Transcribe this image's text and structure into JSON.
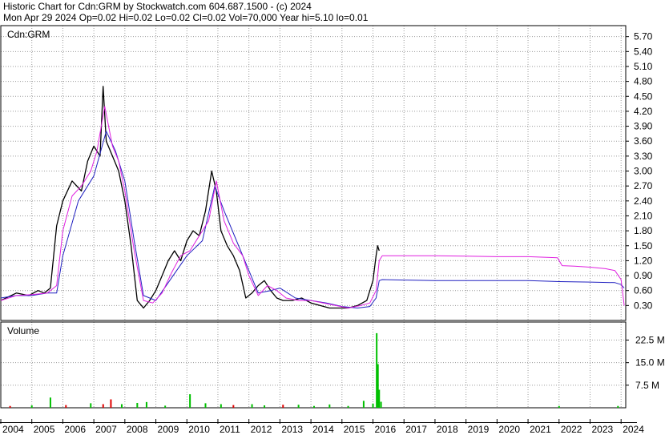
{
  "header": {
    "line1": "Historic Chart for Cdn:GRM by Stockwatch.com 604.687.1500 - (c) 2024",
    "line2": "Mon Apr 29 2024  Op=0.02  Hi=0.02  Lo=0.02  Cl=0.02  Vol=70,000  Year hi=5.10  lo=0.01"
  },
  "colors": {
    "price": "#000000",
    "ma_short": "#e020e0",
    "ma_long": "#2020c0",
    "volume_green": "#00c000",
    "volume_red": "#e00000",
    "grid": "#9a9a9a",
    "background": "#ffffff"
  },
  "chart_data": [
    {
      "type": "line",
      "label": "Cdn:GRM",
      "y_ticks": [
        0.3,
        0.6,
        0.9,
        1.2,
        1.5,
        1.8,
        2.1,
        2.4,
        2.7,
        3.0,
        3.3,
        3.6,
        3.9,
        4.2,
        4.5,
        4.8,
        5.1,
        5.4,
        5.7
      ],
      "y_tick_labels": [
        "0.30",
        "0.60",
        "0.90",
        "1.20",
        "1.50",
        "1.80",
        "2.10",
        "2.40",
        "2.70",
        "3.00",
        "3.30",
        "3.60",
        "3.90",
        "4.20",
        "4.50",
        "4.80",
        "5.10",
        "5.40",
        "5.70"
      ],
      "ylim": [
        0,
        5.92
      ],
      "xlim": [
        2004,
        2024.15
      ],
      "x_tick_labels": [
        "2004",
        "2005",
        "2006",
        "2007",
        "2008",
        "2009",
        "2010",
        "2011",
        "2012",
        "2013",
        "2014",
        "2015",
        "2016",
        "2017",
        "2018",
        "2019",
        "2020",
        "2021",
        "2022",
        "2023",
        "2024"
      ],
      "grid": true,
      "series": [
        {
          "key": "price",
          "x": [
            2004.0,
            2004.5,
            2004.9,
            2005.2,
            2005.4,
            2005.6,
            2005.8,
            2006.0,
            2006.3,
            2006.6,
            2006.8,
            2007.0,
            2007.2,
            2007.3,
            2007.4,
            2007.6,
            2007.8,
            2008.0,
            2008.2,
            2008.4,
            2008.6,
            2008.8,
            2009.0,
            2009.2,
            2009.4,
            2009.6,
            2009.8,
            2010.0,
            2010.2,
            2010.4,
            2010.6,
            2010.8,
            2010.95,
            2011.1,
            2011.3,
            2011.5,
            2011.7,
            2011.9,
            2012.1,
            2012.3,
            2012.5,
            2012.7,
            2012.9,
            2013.1,
            2013.4,
            2013.7,
            2014.0,
            2014.3,
            2014.6,
            2014.9,
            2015.2,
            2015.5,
            2015.8,
            2016.0,
            2016.1,
            2016.15,
            2016.2
          ],
          "y": [
            0.4,
            0.55,
            0.5,
            0.6,
            0.55,
            0.65,
            1.9,
            2.4,
            2.8,
            2.6,
            3.2,
            3.5,
            3.3,
            4.7,
            3.6,
            3.3,
            3.0,
            2.4,
            1.5,
            0.4,
            0.25,
            0.4,
            0.6,
            0.9,
            1.2,
            1.4,
            1.2,
            1.6,
            1.8,
            1.7,
            2.2,
            3.0,
            2.6,
            1.8,
            1.5,
            1.3,
            1.0,
            0.45,
            0.55,
            0.7,
            0.8,
            0.6,
            0.45,
            0.4,
            0.4,
            0.45,
            0.35,
            0.3,
            0.25,
            0.25,
            0.25,
            0.3,
            0.4,
            0.8,
            1.3,
            1.5,
            1.4
          ]
        },
        {
          "key": "ma_short",
          "x": [
            2004.0,
            2004.5,
            2005.0,
            2005.5,
            2005.8,
            2006.0,
            2006.3,
            2006.6,
            2006.9,
            2007.1,
            2007.35,
            2007.6,
            2007.8,
            2008.0,
            2008.3,
            2008.6,
            2008.9,
            2009.2,
            2009.5,
            2009.8,
            2010.1,
            2010.4,
            2010.7,
            2010.95,
            2011.2,
            2011.5,
            2011.8,
            2012.0,
            2012.3,
            2012.6,
            2012.9,
            2013.2,
            2013.6,
            2014.0,
            2014.4,
            2014.8,
            2015.2,
            2015.6,
            2015.9,
            2016.1,
            2016.2,
            2016.3,
            2017.0,
            2018.0,
            2019.0,
            2020.0,
            2021.0,
            2021.95,
            2022.1,
            2022.5,
            2023.0,
            2023.5,
            2023.8,
            2024.0,
            2024.1
          ],
          "y": [
            0.4,
            0.5,
            0.52,
            0.55,
            0.7,
            1.8,
            2.5,
            2.7,
            3.0,
            3.4,
            4.3,
            3.5,
            3.2,
            2.6,
            1.4,
            0.4,
            0.35,
            0.55,
            0.95,
            1.3,
            1.4,
            1.7,
            2.0,
            2.8,
            2.0,
            1.55,
            1.3,
            0.9,
            0.5,
            0.7,
            0.6,
            0.45,
            0.4,
            0.4,
            0.35,
            0.3,
            0.25,
            0.3,
            0.35,
            0.6,
            1.2,
            1.3,
            1.3,
            1.3,
            1.29,
            1.28,
            1.28,
            1.26,
            1.1,
            1.09,
            1.07,
            1.04,
            1.0,
            0.82,
            0.3
          ]
        },
        {
          "key": "ma_long",
          "x": [
            2004.0,
            2004.5,
            2005.0,
            2005.5,
            2005.8,
            2006.0,
            2006.5,
            2007.0,
            2007.4,
            2007.7,
            2008.0,
            2008.3,
            2008.6,
            2009.0,
            2009.5,
            2010.0,
            2010.5,
            2010.9,
            2011.2,
            2011.6,
            2012.0,
            2012.3,
            2012.7,
            2013.0,
            2013.5,
            2014.0,
            2014.5,
            2015.0,
            2015.5,
            2015.9,
            2016.1,
            2016.2,
            2016.3,
            2017.0,
            2018.0,
            2019.0,
            2020.0,
            2021.0,
            2022.0,
            2023.0,
            2023.8,
            2024.0,
            2024.1
          ],
          "y": [
            0.45,
            0.5,
            0.5,
            0.55,
            0.55,
            1.3,
            2.4,
            2.9,
            3.8,
            3.4,
            2.8,
            1.6,
            0.5,
            0.4,
            0.85,
            1.3,
            1.6,
            2.7,
            2.2,
            1.6,
            1.0,
            0.55,
            0.6,
            0.65,
            0.45,
            0.4,
            0.35,
            0.28,
            0.25,
            0.28,
            0.45,
            0.8,
            0.82,
            0.81,
            0.8,
            0.8,
            0.8,
            0.8,
            0.78,
            0.77,
            0.76,
            0.72,
            0.65
          ]
        }
      ]
    },
    {
      "type": "bar",
      "label": "Volume",
      "y_ticks": [
        7.5,
        15.0,
        22.5
      ],
      "y_tick_labels": [
        "7.5 M",
        "15.0 M",
        "22.5 M"
      ],
      "ylim": [
        0,
        28.5
      ],
      "xlim": [
        2004,
        2024.15
      ],
      "grid": true,
      "bars": [
        {
          "x": 2004.3,
          "v": 0.6,
          "c": "red"
        },
        {
          "x": 2005.0,
          "v": 0.8,
          "c": "green"
        },
        {
          "x": 2005.6,
          "v": 3.4,
          "c": "green"
        },
        {
          "x": 2006.1,
          "v": 0.9,
          "c": "red"
        },
        {
          "x": 2006.9,
          "v": 1.5,
          "c": "green"
        },
        {
          "x": 2007.3,
          "v": 1.2,
          "c": "red"
        },
        {
          "x": 2007.55,
          "v": 2.8,
          "c": "red"
        },
        {
          "x": 2007.9,
          "v": 1.2,
          "c": "green"
        },
        {
          "x": 2008.4,
          "v": 1.6,
          "c": "green"
        },
        {
          "x": 2008.7,
          "v": 1.9,
          "c": "green"
        },
        {
          "x": 2009.3,
          "v": 0.7,
          "c": "green"
        },
        {
          "x": 2010.1,
          "v": 4.5,
          "c": "green"
        },
        {
          "x": 2010.6,
          "v": 1.5,
          "c": "green"
        },
        {
          "x": 2011.1,
          "v": 1.2,
          "c": "green"
        },
        {
          "x": 2011.5,
          "v": 0.9,
          "c": "red"
        },
        {
          "x": 2012.1,
          "v": 1.2,
          "c": "green"
        },
        {
          "x": 2012.5,
          "v": 0.8,
          "c": "green"
        },
        {
          "x": 2013.1,
          "v": 1.0,
          "c": "red"
        },
        {
          "x": 2013.6,
          "v": 1.0,
          "c": "green"
        },
        {
          "x": 2014.1,
          "v": 0.6,
          "c": "green"
        },
        {
          "x": 2014.6,
          "v": 1.1,
          "c": "green"
        },
        {
          "x": 2015.2,
          "v": 0.6,
          "c": "green"
        },
        {
          "x": 2015.7,
          "v": 2.3,
          "c": "green"
        },
        {
          "x": 2016.0,
          "v": 1.4,
          "c": "green"
        },
        {
          "x": 2016.12,
          "v": 24.8,
          "c": "green"
        },
        {
          "x": 2016.16,
          "v": 14.5,
          "c": "green"
        },
        {
          "x": 2016.2,
          "v": 6.0,
          "c": "green"
        },
        {
          "x": 2016.26,
          "v": 2.0,
          "c": "green"
        },
        {
          "x": 2022.0,
          "v": 0.6,
          "c": "green"
        },
        {
          "x": 2023.9,
          "v": 0.6,
          "c": "green"
        }
      ]
    }
  ]
}
